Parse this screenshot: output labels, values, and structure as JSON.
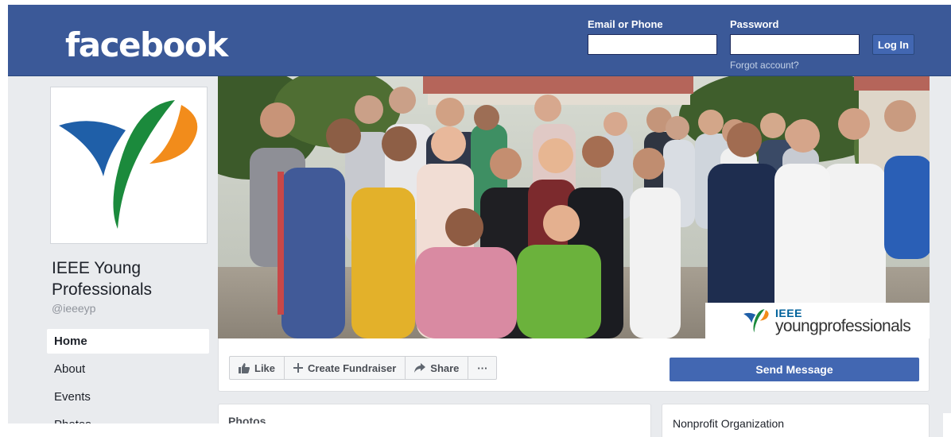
{
  "header": {
    "logo": "facebook",
    "email_label": "Email or Phone",
    "password_label": "Password",
    "email_value": "",
    "password_value": "",
    "login_button": "Log In",
    "forgot_link": "Forgot account?"
  },
  "page": {
    "name": "IEEE Young Professionals",
    "handle": "@ieeeyp",
    "cover_badge_ieee": "IEEE",
    "cover_badge_yp": "youngprofessionals"
  },
  "nav": {
    "items": [
      {
        "label": "Home",
        "active": true
      },
      {
        "label": "About",
        "active": false
      },
      {
        "label": "Events",
        "active": false
      },
      {
        "label": "Photos",
        "active": false
      }
    ]
  },
  "actions": {
    "like": "Like",
    "create_fundraiser": "Create Fundraiser",
    "share": "Share",
    "more": "···",
    "send_message": "Send Message"
  },
  "cards": {
    "photos_title": "Photos",
    "category": "Nonprofit Organization"
  },
  "colors": {
    "brand_blue": "#3b5998",
    "button_blue": "#4267b2",
    "page_bg": "#e9ebee",
    "logo_blue": "#1f5fa8",
    "logo_green": "#1b8a3c",
    "logo_orange": "#f28c1b"
  }
}
